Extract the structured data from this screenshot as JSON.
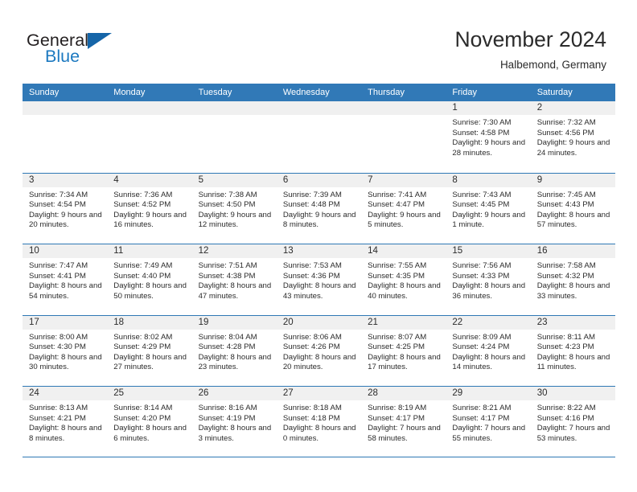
{
  "brand": {
    "name_top": "General",
    "name_bottom": "Blue",
    "accent_color": "#1c79c0",
    "triangle_color": "#1565a8"
  },
  "header": {
    "title": "November 2024",
    "subtitle": "Halbemond, Germany"
  },
  "theme": {
    "header_bar_color": "#3179b7",
    "row_divider_color": "#2f78b5",
    "day_number_band_color": "#f0f0f0",
    "text_color": "#2b2b2b"
  },
  "weekdays": [
    "Sunday",
    "Monday",
    "Tuesday",
    "Wednesday",
    "Thursday",
    "Friday",
    "Saturday"
  ],
  "labels": {
    "sunrise_prefix": "Sunrise:",
    "sunset_prefix": "Sunset:",
    "daylight_prefix": "Daylight:"
  },
  "weeks": [
    [
      {
        "day": "",
        "empty": true
      },
      {
        "day": "",
        "empty": true
      },
      {
        "day": "",
        "empty": true
      },
      {
        "day": "",
        "empty": true
      },
      {
        "day": "",
        "empty": true
      },
      {
        "day": "1",
        "sunrise": "Sunrise: 7:30 AM",
        "sunset": "Sunset: 4:58 PM",
        "daylight": "Daylight: 9 hours and 28 minutes."
      },
      {
        "day": "2",
        "sunrise": "Sunrise: 7:32 AM",
        "sunset": "Sunset: 4:56 PM",
        "daylight": "Daylight: 9 hours and 24 minutes."
      }
    ],
    [
      {
        "day": "3",
        "sunrise": "Sunrise: 7:34 AM",
        "sunset": "Sunset: 4:54 PM",
        "daylight": "Daylight: 9 hours and 20 minutes."
      },
      {
        "day": "4",
        "sunrise": "Sunrise: 7:36 AM",
        "sunset": "Sunset: 4:52 PM",
        "daylight": "Daylight: 9 hours and 16 minutes."
      },
      {
        "day": "5",
        "sunrise": "Sunrise: 7:38 AM",
        "sunset": "Sunset: 4:50 PM",
        "daylight": "Daylight: 9 hours and 12 minutes."
      },
      {
        "day": "6",
        "sunrise": "Sunrise: 7:39 AM",
        "sunset": "Sunset: 4:48 PM",
        "daylight": "Daylight: 9 hours and 8 minutes."
      },
      {
        "day": "7",
        "sunrise": "Sunrise: 7:41 AM",
        "sunset": "Sunset: 4:47 PM",
        "daylight": "Daylight: 9 hours and 5 minutes."
      },
      {
        "day": "8",
        "sunrise": "Sunrise: 7:43 AM",
        "sunset": "Sunset: 4:45 PM",
        "daylight": "Daylight: 9 hours and 1 minute."
      },
      {
        "day": "9",
        "sunrise": "Sunrise: 7:45 AM",
        "sunset": "Sunset: 4:43 PM",
        "daylight": "Daylight: 8 hours and 57 minutes."
      }
    ],
    [
      {
        "day": "10",
        "sunrise": "Sunrise: 7:47 AM",
        "sunset": "Sunset: 4:41 PM",
        "daylight": "Daylight: 8 hours and 54 minutes."
      },
      {
        "day": "11",
        "sunrise": "Sunrise: 7:49 AM",
        "sunset": "Sunset: 4:40 PM",
        "daylight": "Daylight: 8 hours and 50 minutes."
      },
      {
        "day": "12",
        "sunrise": "Sunrise: 7:51 AM",
        "sunset": "Sunset: 4:38 PM",
        "daylight": "Daylight: 8 hours and 47 minutes."
      },
      {
        "day": "13",
        "sunrise": "Sunrise: 7:53 AM",
        "sunset": "Sunset: 4:36 PM",
        "daylight": "Daylight: 8 hours and 43 minutes."
      },
      {
        "day": "14",
        "sunrise": "Sunrise: 7:55 AM",
        "sunset": "Sunset: 4:35 PM",
        "daylight": "Daylight: 8 hours and 40 minutes."
      },
      {
        "day": "15",
        "sunrise": "Sunrise: 7:56 AM",
        "sunset": "Sunset: 4:33 PM",
        "daylight": "Daylight: 8 hours and 36 minutes."
      },
      {
        "day": "16",
        "sunrise": "Sunrise: 7:58 AM",
        "sunset": "Sunset: 4:32 PM",
        "daylight": "Daylight: 8 hours and 33 minutes."
      }
    ],
    [
      {
        "day": "17",
        "sunrise": "Sunrise: 8:00 AM",
        "sunset": "Sunset: 4:30 PM",
        "daylight": "Daylight: 8 hours and 30 minutes."
      },
      {
        "day": "18",
        "sunrise": "Sunrise: 8:02 AM",
        "sunset": "Sunset: 4:29 PM",
        "daylight": "Daylight: 8 hours and 27 minutes."
      },
      {
        "day": "19",
        "sunrise": "Sunrise: 8:04 AM",
        "sunset": "Sunset: 4:28 PM",
        "daylight": "Daylight: 8 hours and 23 minutes."
      },
      {
        "day": "20",
        "sunrise": "Sunrise: 8:06 AM",
        "sunset": "Sunset: 4:26 PM",
        "daylight": "Daylight: 8 hours and 20 minutes."
      },
      {
        "day": "21",
        "sunrise": "Sunrise: 8:07 AM",
        "sunset": "Sunset: 4:25 PM",
        "daylight": "Daylight: 8 hours and 17 minutes."
      },
      {
        "day": "22",
        "sunrise": "Sunrise: 8:09 AM",
        "sunset": "Sunset: 4:24 PM",
        "daylight": "Daylight: 8 hours and 14 minutes."
      },
      {
        "day": "23",
        "sunrise": "Sunrise: 8:11 AM",
        "sunset": "Sunset: 4:23 PM",
        "daylight": "Daylight: 8 hours and 11 minutes."
      }
    ],
    [
      {
        "day": "24",
        "sunrise": "Sunrise: 8:13 AM",
        "sunset": "Sunset: 4:21 PM",
        "daylight": "Daylight: 8 hours and 8 minutes."
      },
      {
        "day": "25",
        "sunrise": "Sunrise: 8:14 AM",
        "sunset": "Sunset: 4:20 PM",
        "daylight": "Daylight: 8 hours and 6 minutes."
      },
      {
        "day": "26",
        "sunrise": "Sunrise: 8:16 AM",
        "sunset": "Sunset: 4:19 PM",
        "daylight": "Daylight: 8 hours and 3 minutes."
      },
      {
        "day": "27",
        "sunrise": "Sunrise: 8:18 AM",
        "sunset": "Sunset: 4:18 PM",
        "daylight": "Daylight: 8 hours and 0 minutes."
      },
      {
        "day": "28",
        "sunrise": "Sunrise: 8:19 AM",
        "sunset": "Sunset: 4:17 PM",
        "daylight": "Daylight: 7 hours and 58 minutes."
      },
      {
        "day": "29",
        "sunrise": "Sunrise: 8:21 AM",
        "sunset": "Sunset: 4:17 PM",
        "daylight": "Daylight: 7 hours and 55 minutes."
      },
      {
        "day": "30",
        "sunrise": "Sunrise: 8:22 AM",
        "sunset": "Sunset: 4:16 PM",
        "daylight": "Daylight: 7 hours and 53 minutes."
      }
    ]
  ]
}
